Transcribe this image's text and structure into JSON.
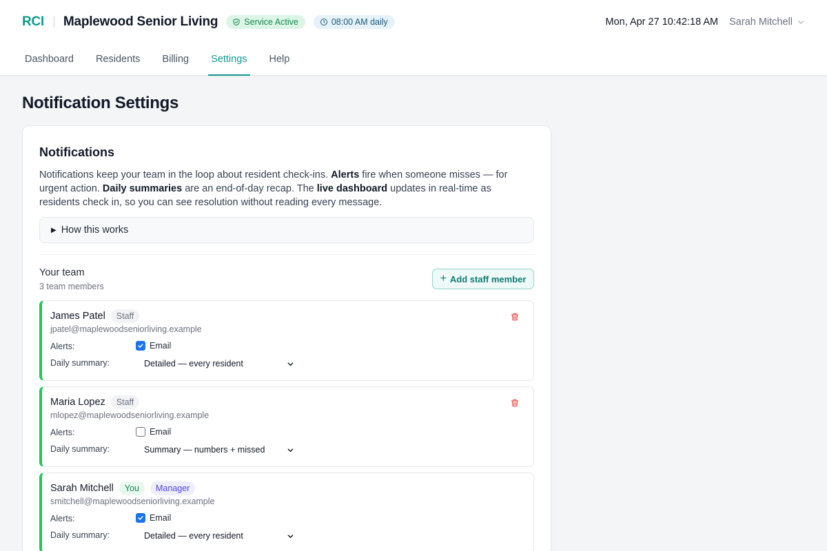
{
  "header": {
    "brand": "RCI",
    "facility": "Maplewood Senior Living",
    "status_pill": "Service Active",
    "schedule_pill": "08:00 AM daily",
    "datetime": "Mon, Apr 27 10:42:18 AM",
    "user_name": "Sarah Mitchell"
  },
  "nav": {
    "tabs": [
      {
        "label": "Dashboard",
        "active": false
      },
      {
        "label": "Residents",
        "active": false
      },
      {
        "label": "Billing",
        "active": false
      },
      {
        "label": "Settings",
        "active": true
      },
      {
        "label": "Help",
        "active": false
      }
    ]
  },
  "page": {
    "title": "Notification Settings"
  },
  "notifications": {
    "title": "Notifications",
    "intro": {
      "p1": "Notifications keep your team in the loop about resident check-ins. ",
      "b1": "Alerts",
      "p2": " fire when someone misses — for urgent action. ",
      "b2": "Daily summaries",
      "p3": " are an end-of-day recap. The ",
      "b3": "live dashboard",
      "p4": " updates in real-time as residents check in, so you can see resolution without reading every message."
    },
    "how_label": "How this works",
    "team_label": "Your team",
    "team_count": "3 team members",
    "add_button": "Add staff member",
    "alerts_label": "Alerts:",
    "summary_label": "Daily summary:",
    "members": [
      {
        "name": "James Patel",
        "you": "",
        "role": "Staff",
        "email": "jpatel@maplewoodseniorliving.example",
        "alert_channel": "Email",
        "alert_checked": true,
        "summary": "Detailed — every resident",
        "deletable": true
      },
      {
        "name": "Maria Lopez",
        "you": "",
        "role": "Staff",
        "email": "mlopez@maplewoodseniorliving.example",
        "alert_channel": "Email",
        "alert_checked": false,
        "summary": "Summary — numbers + missed",
        "deletable": true
      },
      {
        "name": "Sarah Mitchell",
        "you": "You",
        "role": "Manager",
        "email": "smitchell@maplewoodseniorliving.example",
        "alert_channel": "Email",
        "alert_checked": true,
        "summary": "Detailed — every resident",
        "deletable": false
      }
    ]
  },
  "colors": {
    "accent": "#0f9b8e",
    "member_border": "#22c55e",
    "checkbox_on": "#1a73e8",
    "trash": "#ef4444"
  },
  "icons": {
    "status": "shield-check-icon",
    "schedule": "clock-icon",
    "user_menu": "chevron-down-icon",
    "expand": "triangle-right-icon",
    "add": "plus-icon",
    "delete": "trash-icon",
    "select": "chevron-down-icon"
  }
}
